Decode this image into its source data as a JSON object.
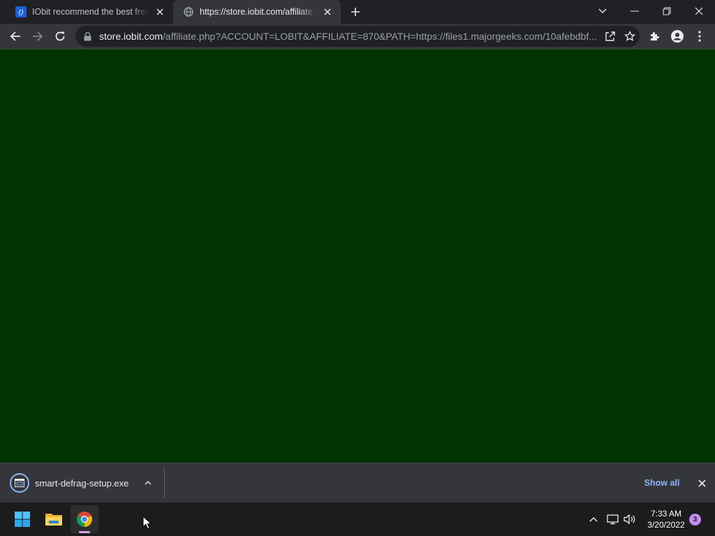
{
  "browser": {
    "tabs": [
      {
        "title": "IObit recommend the best free, f",
        "favicon": "iobit-favicon",
        "active": false
      },
      {
        "title": "https://store.iobit.com/affiliate.ph",
        "favicon": "globe-icon",
        "active": true
      }
    ],
    "address_bar": {
      "host": "store.iobit.com",
      "path": "/affiliate.php?ACCOUNT=LOBIT&AFFILIATE=870&PATH=https://files1.majorgeeks.com/10afebdbf..."
    }
  },
  "page": {
    "background": "#003300"
  },
  "download_bar": {
    "file_name": "smart-defrag-setup.exe",
    "show_all_label": "Show all"
  },
  "taskbar": {
    "time": "7:33 AM",
    "date": "3/20/2022",
    "notification_count": "3"
  },
  "colors": {
    "accent_blue": "#8ab4f8",
    "toolbar": "#35363a",
    "frame": "#202124",
    "taskbar": "#1c1c1c"
  }
}
